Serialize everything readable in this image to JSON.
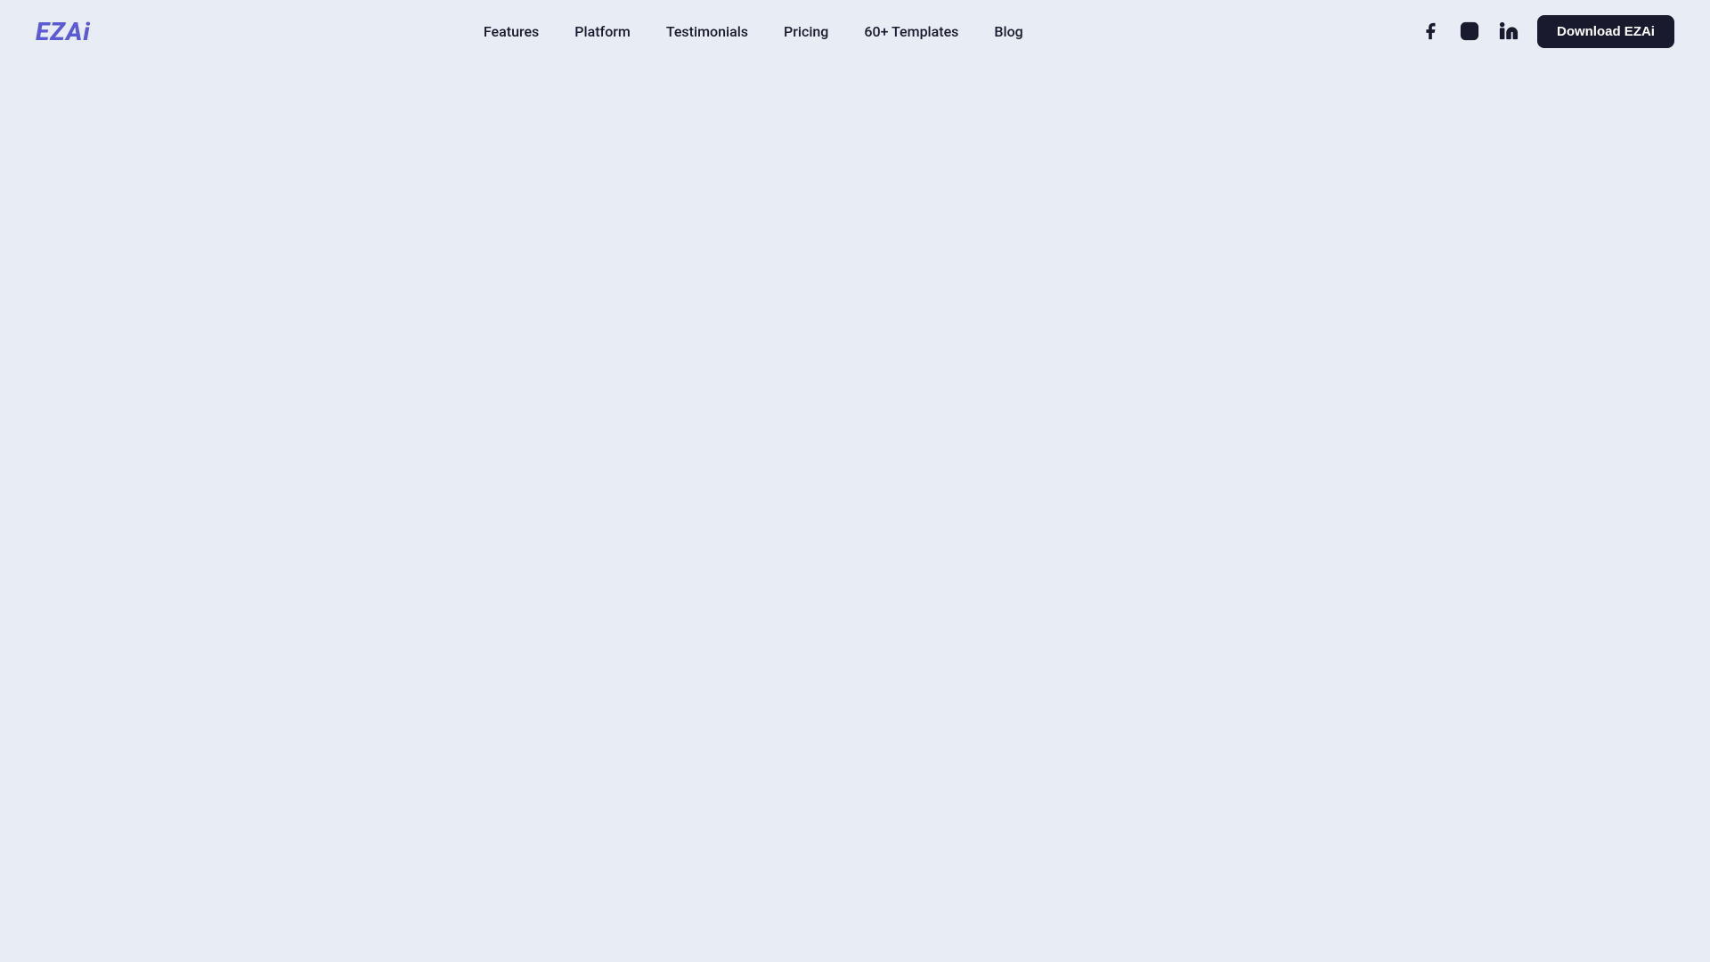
{
  "brand": {
    "logo_text": "EZAi"
  },
  "nav": {
    "items": [
      {
        "label": "Features",
        "id": "features"
      },
      {
        "label": "Platform",
        "id": "platform"
      },
      {
        "label": "Testimonials",
        "id": "testimonials"
      },
      {
        "label": "Pricing",
        "id": "pricing"
      },
      {
        "label": "60+ Templates",
        "id": "templates"
      },
      {
        "label": "Blog",
        "id": "blog"
      }
    ]
  },
  "social": {
    "facebook_label": "facebook",
    "instagram_label": "instagram",
    "linkedin_label": "linkedin"
  },
  "cta": {
    "download_label": "Download EZAi"
  },
  "colors": {
    "background": "#e8ecf5",
    "logo": "#5b5bd6",
    "nav_text": "#1a1a2e",
    "btn_bg": "#1a1a2e",
    "btn_text": "#ffffff"
  }
}
